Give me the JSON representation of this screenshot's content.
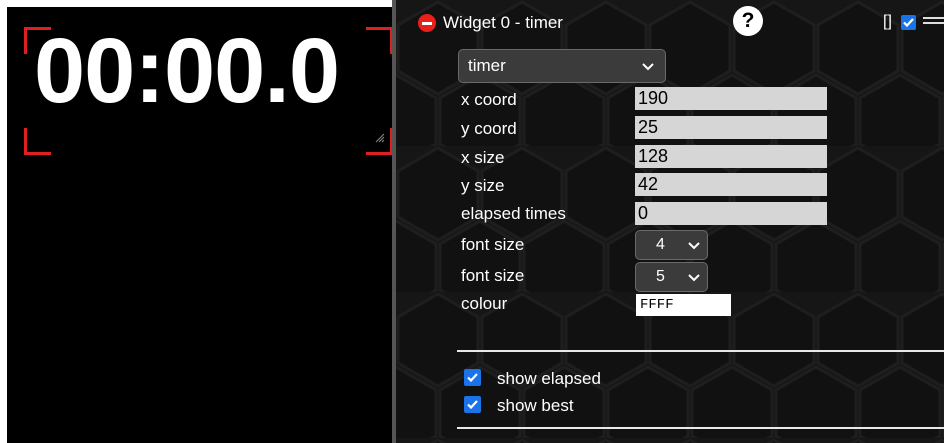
{
  "preview": {
    "timer_display": "00:00.0"
  },
  "panel": {
    "title": "Widget 0 - timer",
    "help_label": "?",
    "bracket_label": "[]",
    "type_select": {
      "value": "timer"
    },
    "fields": {
      "x_coord": {
        "label": "x coord",
        "value": "190"
      },
      "y_coord": {
        "label": "y coord",
        "value": "25"
      },
      "x_size": {
        "label": "x size",
        "value": "128"
      },
      "y_size": {
        "label": "y size",
        "value": "42"
      },
      "elapsed_times": {
        "label": "elapsed times",
        "value": "0"
      },
      "font_size_1": {
        "label": "font size",
        "value": "4"
      },
      "font_size_2": {
        "label": "font size",
        "value": "5"
      },
      "colour": {
        "label": "colour",
        "value": "FFFF"
      }
    },
    "checkboxes": {
      "show_elapsed": {
        "label": "show elapsed",
        "checked": true
      },
      "show_best": {
        "label": "show best",
        "checked": true
      }
    }
  },
  "colors": {
    "accent": "#1a73e8",
    "remove": "#e8201c",
    "frame": "#e0201e"
  }
}
